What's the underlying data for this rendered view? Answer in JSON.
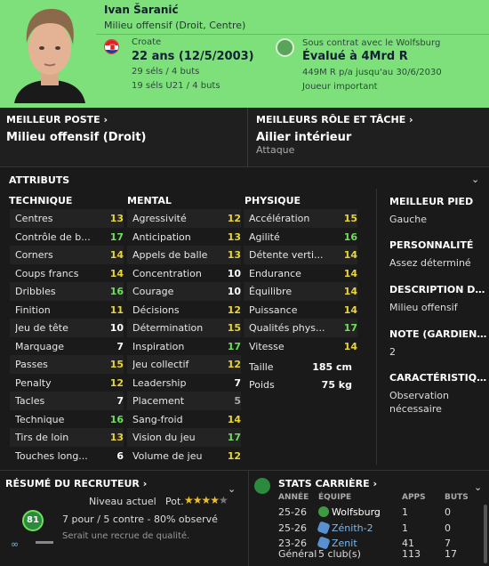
{
  "player": {
    "name": "Ivan Šaranić",
    "position": "Milieu offensif (Droit, Centre)",
    "nationality": "Croate",
    "age": "22 ans (12/5/2003)",
    "caps_senior": "29 séls / 4 buts",
    "caps_u21": "19 séls U21 / 4 buts",
    "contract": "Sous contrat avec le Wolfsburg",
    "value": "Évalué à 4Mrd R",
    "wage": "449M R p/a jusqu'au 30/6/2030",
    "status": "Joueur important"
  },
  "best_position": {
    "label": "MEILLEUR POSTE",
    "value": "Milieu offensif (Droit)"
  },
  "best_role": {
    "label": "MEILLEURS RÔLE ET TÂCHE",
    "value": "Ailier intérieur",
    "duty": "Attaque"
  },
  "attributes": {
    "title": "ATTRIBUTS",
    "technical_title": "TECHNIQUE",
    "mental_title": "MENTAL",
    "physical_title": "PHYSIQUE",
    "technical": [
      {
        "label": "Centres",
        "value": "13",
        "color": "yellow"
      },
      {
        "label": "Contrôle de b...",
        "value": "17",
        "color": "green"
      },
      {
        "label": "Corners",
        "value": "14",
        "color": "yellow"
      },
      {
        "label": "Coups francs",
        "value": "14",
        "color": "yellow"
      },
      {
        "label": "Dribbles",
        "value": "16",
        "color": "green"
      },
      {
        "label": "Finition",
        "value": "11",
        "color": "yellow"
      },
      {
        "label": "Jeu de tête",
        "value": "10",
        "color": "white"
      },
      {
        "label": "Marquage",
        "value": "7",
        "color": "white"
      },
      {
        "label": "Passes",
        "value": "15",
        "color": "yellow"
      },
      {
        "label": "Penalty",
        "value": "12",
        "color": "yellow"
      },
      {
        "label": "Tacles",
        "value": "7",
        "color": "white"
      },
      {
        "label": "Technique",
        "value": "16",
        "color": "green"
      },
      {
        "label": "Tirs de loin",
        "value": "13",
        "color": "yellow"
      },
      {
        "label": "Touches long...",
        "value": "6",
        "color": "white"
      }
    ],
    "mental": [
      {
        "label": "Agressivité",
        "value": "12",
        "color": "yellow"
      },
      {
        "label": "Anticipation",
        "value": "13",
        "color": "yellow"
      },
      {
        "label": "Appels de balle",
        "value": "13",
        "color": "yellow"
      },
      {
        "label": "Concentration",
        "value": "10",
        "color": "white"
      },
      {
        "label": "Courage",
        "value": "10",
        "color": "white"
      },
      {
        "label": "Décisions",
        "value": "12",
        "color": "yellow"
      },
      {
        "label": "Détermination",
        "value": "15",
        "color": "yellow"
      },
      {
        "label": "Inspiration",
        "value": "17",
        "color": "green"
      },
      {
        "label": "Jeu collectif",
        "value": "12",
        "color": "yellow"
      },
      {
        "label": "Leadership",
        "value": "7",
        "color": "white"
      },
      {
        "label": "Placement",
        "value": "5",
        "color": "grey"
      },
      {
        "label": "Sang-froid",
        "value": "14",
        "color": "yellow"
      },
      {
        "label": "Vision du jeu",
        "value": "17",
        "color": "green"
      },
      {
        "label": "Volume de jeu",
        "value": "12",
        "color": "yellow"
      }
    ],
    "physical": [
      {
        "label": "Accélération",
        "value": "15",
        "color": "yellow"
      },
      {
        "label": "Agilité",
        "value": "16",
        "color": "green"
      },
      {
        "label": "Détente verti...",
        "value": "14",
        "color": "yellow"
      },
      {
        "label": "Endurance",
        "value": "14",
        "color": "yellow"
      },
      {
        "label": "Équilibre",
        "value": "14",
        "color": "yellow"
      },
      {
        "label": "Puissance",
        "value": "14",
        "color": "yellow"
      },
      {
        "label": "Qualités phys...",
        "value": "17",
        "color": "green"
      },
      {
        "label": "Vitesse",
        "value": "14",
        "color": "yellow"
      }
    ],
    "height_label": "Taille",
    "height": "185 cm",
    "weight_label": "Poids",
    "weight": "75 kg"
  },
  "side_info": {
    "best_foot_title": "MEILLEUR PIED",
    "best_foot": "Gauche",
    "personality_title": "PERSONNALITÉ",
    "personality": "Assez déterminé",
    "description_title": "DESCRIPTION DES...",
    "description": "Milieu offensif",
    "gk_rating_title": "NOTE (GARDIEN D...",
    "gk_rating": "2",
    "characteristics_title": "CARACTÉRISTIQU...",
    "characteristics": "Observation nécessaire"
  },
  "scout": {
    "title": "RÉSUMÉ DU RECRUTEUR",
    "current_label": "Niveau actuel",
    "potential_label": "Pot.",
    "potential_stars": 4.5,
    "ca_badge": "81",
    "pros_cons": "7 pour / 5 contre - 80% observé",
    "summary": "Serait une recrue de qualité."
  },
  "career": {
    "title": "STATS CARRIÈRE",
    "headers": {
      "season": "ANNÉE",
      "team": "ÉQUIPE",
      "apps": "APPS",
      "goals": "BUTS"
    },
    "rows": [
      {
        "season": "25-26",
        "team": "Wolfsburg",
        "apps": "1",
        "goals": "0",
        "alt": false
      },
      {
        "season": "25-26",
        "team": "Zénith-2",
        "apps": "1",
        "goals": "0",
        "alt": true
      },
      {
        "season": "23-26",
        "team": "Zenit",
        "apps": "41",
        "goals": "7",
        "alt": true
      }
    ],
    "total_label": "Général",
    "total_clubs": "5 club(s)",
    "total_apps": "113",
    "total_goals": "17"
  },
  "colors": {
    "header_bg": "#7ee07a",
    "value_yellow": "#e8d53a",
    "value_green": "#6fe05a",
    "value_white": "#ffffff"
  }
}
